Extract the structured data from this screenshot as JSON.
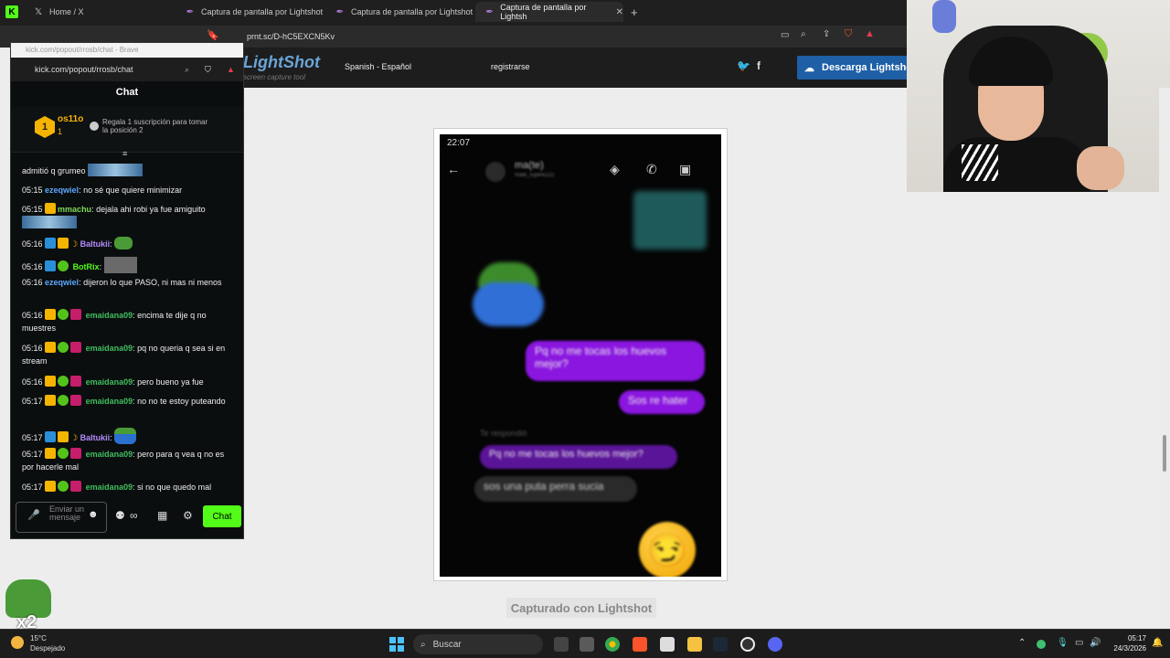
{
  "browser": {
    "tabs": [
      {
        "label": "Home / X",
        "icon": "x-logo-icon"
      },
      {
        "label": "Captura de pantalla por Lightshot",
        "icon": "lightshot-feather-icon"
      },
      {
        "label": "Captura de pantalla por Lightshot",
        "icon": "lightshot-feather-icon"
      },
      {
        "label": "Captura de pantalla por Lightsh",
        "icon": "lightshot-feather-icon",
        "active": true
      }
    ],
    "new_tab": "+",
    "url": "prnt.sc/D-hC5EXCN5Kv",
    "kick_icon_label": "K"
  },
  "lightshot": {
    "logo": "LightShot",
    "tagline": "screen capture tool",
    "language": "Spanish - Español",
    "register": "registrarse",
    "download_button": "Descarga Lightshot",
    "captured_label": "Capturado con Lightshot"
  },
  "phone_screenshot": {
    "status_time": "22:07",
    "contact_name": "ma(te)",
    "contact_handle": "mate_fuyere222",
    "bubble1": "Pq no me tocas los huevos mejor?",
    "bubble2": "Sos re hater",
    "replied_label": "Te respondió",
    "quoted": "Pq no me tocas los huevos mejor?",
    "reply": "sos una puta perra sucia",
    "emoji": "😏"
  },
  "chat_window": {
    "title": "kick.com/popout/rrosb/chat - Brave",
    "url": "kick.com/popout/rrosb/chat",
    "header": "Chat",
    "pinned": {
      "rank": "1",
      "user": "os11o",
      "count": "1",
      "message": "Regala 1 suscripción para tomar la posición 2"
    },
    "messages": [
      {
        "time": "",
        "user": "",
        "text": "admitió q grumeo"
      },
      {
        "time": "05:15",
        "user": "ezeqwiel",
        "text": "no sé que quiere minimizar"
      },
      {
        "time": "05:15",
        "user": "mmachu",
        "text": "dejala ahi robi ya fue amiguito"
      },
      {
        "time": "05:16",
        "user": "Baltukii",
        "text": ""
      },
      {
        "time": "05:16",
        "user": "BotRix",
        "text": ""
      },
      {
        "time": "05:16",
        "user": "ezeqwiel",
        "text": "dijeron lo que PASO, ni mas ni menos"
      },
      {
        "time": "05:16",
        "user": "emaidana09",
        "text": "encima te dije q no muestres"
      },
      {
        "time": "05:16",
        "user": "emaidana09",
        "text": "pq no queria q sea si en stream"
      },
      {
        "time": "05:16",
        "user": "emaidana09",
        "text": "pero bueno ya fue"
      },
      {
        "time": "05:17",
        "user": "emaidana09",
        "text": "no no te estoy puteando"
      },
      {
        "time": "05:17",
        "user": "Baltukii",
        "text": ""
      },
      {
        "time": "05:17",
        "user": "emaidana09",
        "text": "pero para q vea q no es por hacerle mal"
      },
      {
        "time": "05:17",
        "user": "emaidana09",
        "text": "si no que quedo mal"
      }
    ],
    "input_placeholder": "Enviar un mensaje",
    "send_button": "Chat"
  },
  "overlay": {
    "multiplier": "x2"
  },
  "taskbar": {
    "weather_temp": "15°C",
    "weather_desc": "Despejado",
    "search_placeholder": "Buscar",
    "time": "05:17",
    "date": "24/3/2026"
  }
}
